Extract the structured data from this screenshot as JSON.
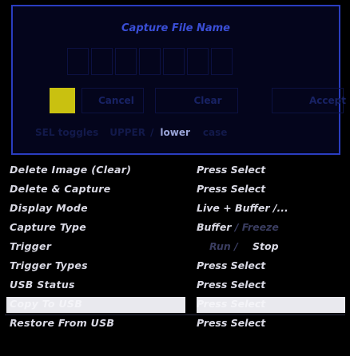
{
  "dialog": {
    "title": "Capture File Name",
    "char_slots": 7,
    "buttons": {
      "cancel": "Cancel",
      "clear": "Clear",
      "accept": "Accept"
    },
    "toggle": {
      "hint": "SEL toggles",
      "upper": "UPPER",
      "separator": "/",
      "lower": "lower",
      "case_word": "case"
    }
  },
  "menu": {
    "items": [
      {
        "label": "Delete Image (Clear)",
        "value": "Press Select"
      },
      {
        "label": "Delete & Capture",
        "value": "Press Select"
      },
      {
        "label": "Display Mode",
        "value": "Live + Buffer /..."
      },
      {
        "label": "Capture Type",
        "value": "Buffer",
        "value_dim": "/ Freeze"
      },
      {
        "label": "Trigger",
        "value_dim": "Run /",
        "value": "Stop"
      },
      {
        "label": "Trigger Types",
        "value": "Press Select"
      },
      {
        "label": "USB Status",
        "value": "Press Select"
      },
      {
        "label": "Copy To USB",
        "value": "Press Select",
        "highlighted": true
      },
      {
        "label": "Restore From USB",
        "value": "Press Select"
      }
    ]
  },
  "colors": {
    "accent": "#2a3dc0",
    "cursor": "#c9c110",
    "highlight": "#e9e9ee",
    "text": "#d9d9e4"
  }
}
